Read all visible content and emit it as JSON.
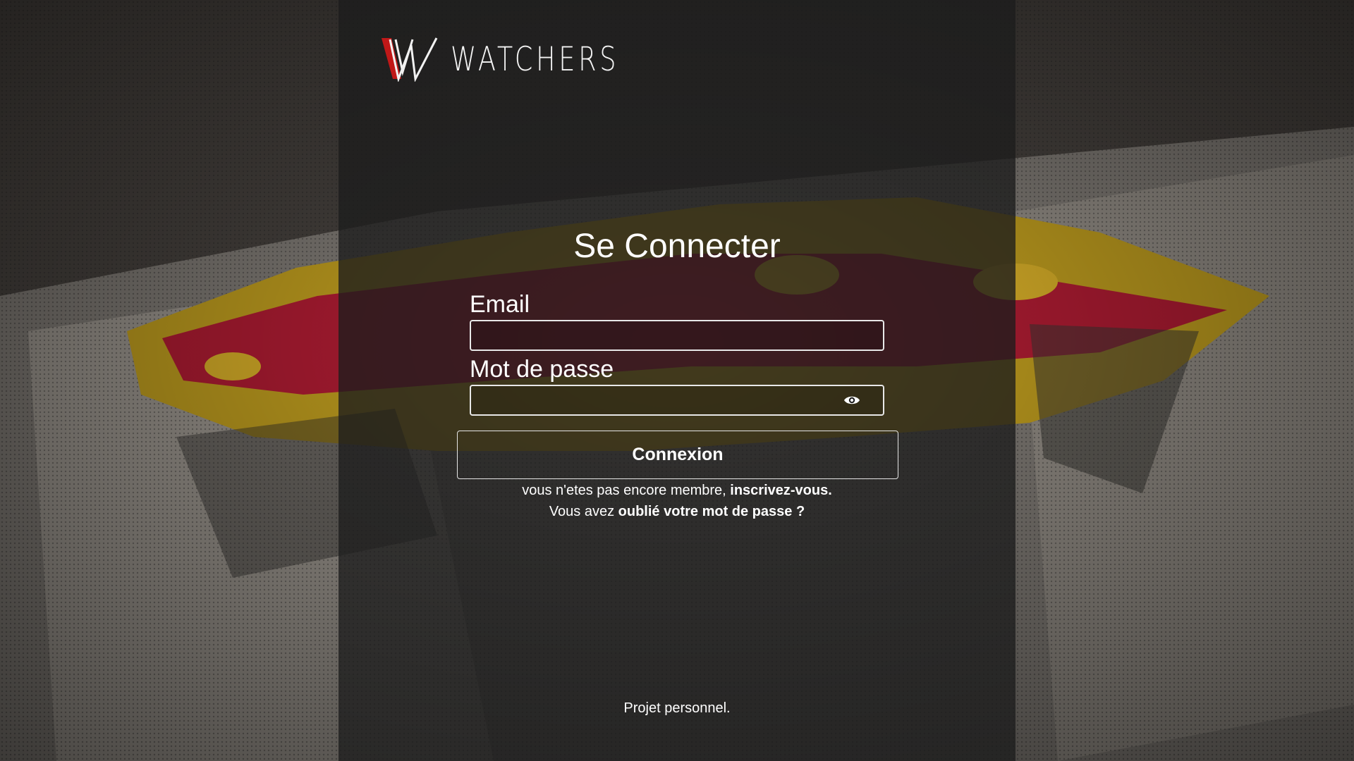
{
  "brand": {
    "name": "WATCHERS",
    "accent_color": "#c01818",
    "logo_icon": "watchers-w-logo-icon"
  },
  "login": {
    "title": "Se Connecter",
    "email_label": "Email",
    "email_value": "",
    "password_label": "Mot de passe",
    "password_value": "",
    "password_toggle_icon": "eye-icon",
    "submit_label": "Connexion",
    "signup_prefix": "vous n'etes pas encore membre, ",
    "signup_link": "inscrivez-vous.",
    "forgot_prefix": "Vous avez ",
    "forgot_link": "oublié votre mot de passe ?"
  },
  "footer": {
    "text": "Projet personnel."
  }
}
